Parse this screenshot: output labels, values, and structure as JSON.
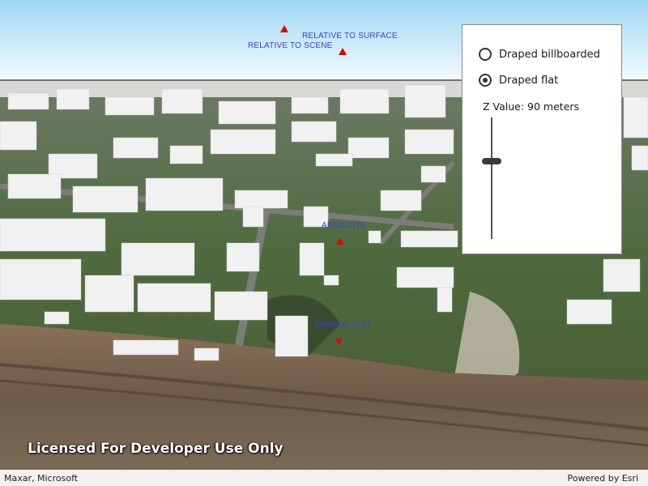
{
  "scene": {
    "labels": {
      "relative_to_surface": "RELATIVE TO SURFACE",
      "relative_to_scene": "RELATIVE TO SCENE",
      "absolute": "ABSOLUTE",
      "draped_flat": "DRAPED FLAT"
    },
    "marker_color": "#e60000",
    "label_color": "#3a3fd6"
  },
  "panel": {
    "options": [
      {
        "label": "Draped billboarded",
        "checked": false
      },
      {
        "label": "Draped flat",
        "checked": true
      }
    ],
    "z_label": "Z Value: 90 meters",
    "z_value_meters": 90
  },
  "watermark": "Licensed For Developer Use Only",
  "attribution": {
    "left": "Maxar, Microsoft",
    "right": "Powered by Esri"
  }
}
